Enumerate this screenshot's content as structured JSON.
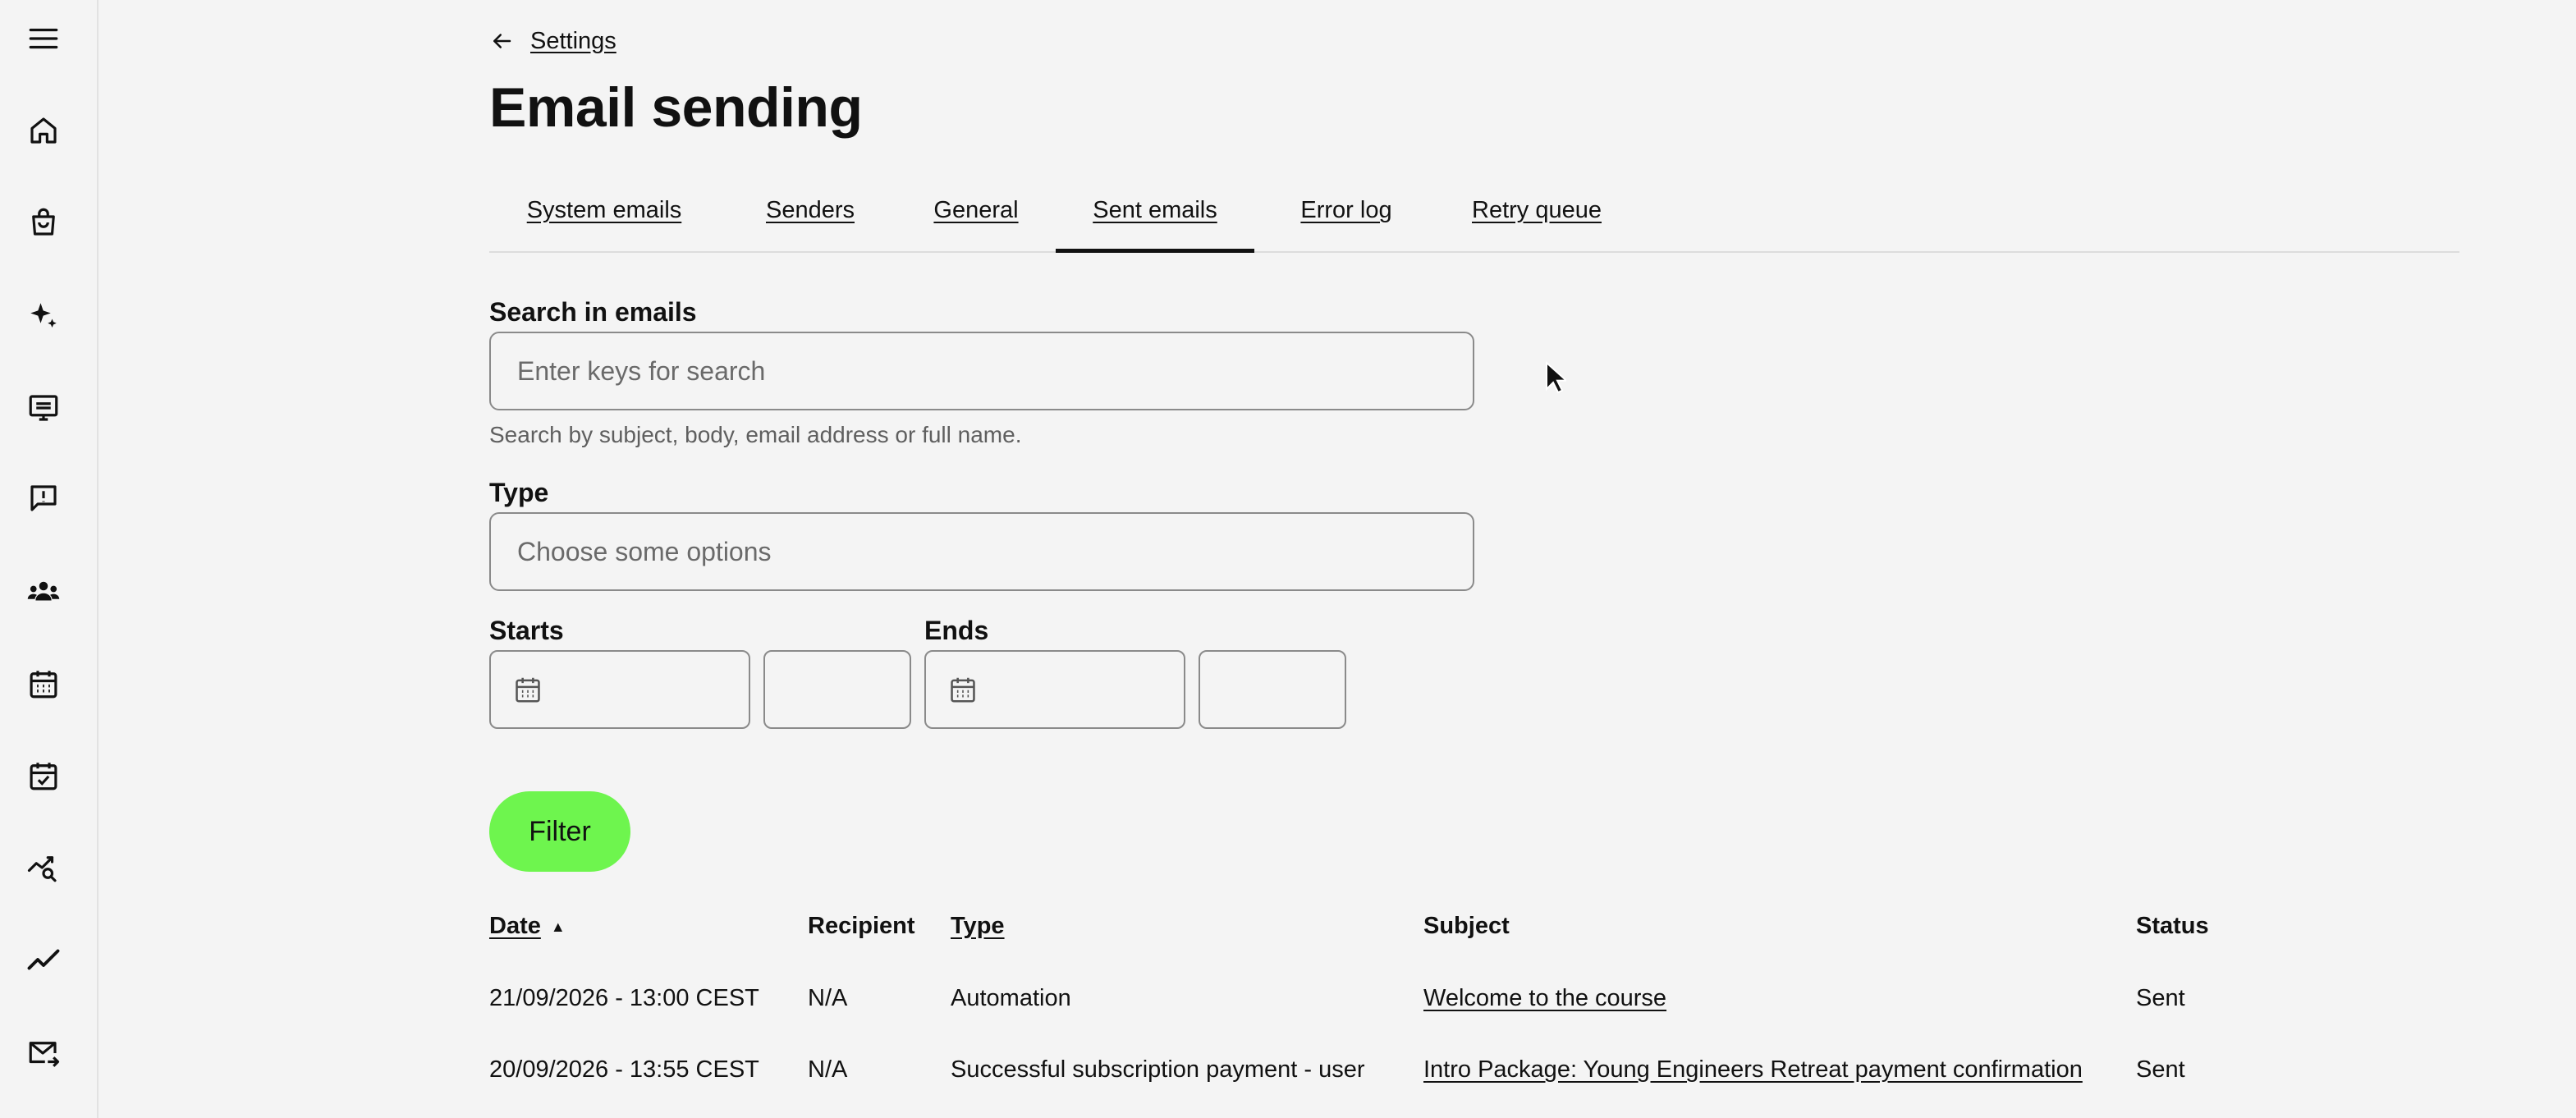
{
  "sidebar": {
    "items": [
      {
        "icon": "menu-icon"
      },
      {
        "icon": "home-icon"
      },
      {
        "icon": "shopping-bag-icon"
      },
      {
        "icon": "sparkles-icon"
      },
      {
        "icon": "presentation-icon"
      },
      {
        "icon": "alert-message-icon"
      },
      {
        "icon": "users-icon"
      },
      {
        "icon": "calendar-icon"
      },
      {
        "icon": "calendar-check-icon"
      },
      {
        "icon": "analytics-search-icon"
      },
      {
        "icon": "trend-line-icon"
      },
      {
        "icon": "mail-forward-icon"
      }
    ]
  },
  "breadcrumb": {
    "back_label": "Settings"
  },
  "page": {
    "title": "Email sending"
  },
  "tabs": [
    {
      "label": "System emails",
      "active": false
    },
    {
      "label": "Senders",
      "active": false
    },
    {
      "label": "General",
      "active": false
    },
    {
      "label": "Sent emails",
      "active": true
    },
    {
      "label": "Error log",
      "active": false
    },
    {
      "label": "Retry queue",
      "active": false
    }
  ],
  "filters": {
    "search_label": "Search in emails",
    "search_placeholder": "Enter keys for search",
    "search_value": "",
    "search_help": "Search by subject, body, email address or full name.",
    "type_label": "Type",
    "type_placeholder": "Choose some options",
    "starts_label": "Starts",
    "ends_label": "Ends",
    "filter_button": "Filter"
  },
  "table": {
    "columns": [
      {
        "label": "Date",
        "sortable": true,
        "sort": "asc"
      },
      {
        "label": "Recipient",
        "sortable": false
      },
      {
        "label": "Type",
        "sortable": true
      },
      {
        "label": "Subject",
        "sortable": false
      },
      {
        "label": "Status",
        "sortable": false
      }
    ],
    "sort_arrow": "▲",
    "rows": [
      {
        "date": "21/09/2026 - 13:00 CEST",
        "recipient": "N/A",
        "type": "Automation",
        "subject": "Welcome to the course",
        "status": "Sent"
      },
      {
        "date": "20/09/2026 - 13:55 CEST",
        "recipient": "N/A",
        "type": "Successful subscription payment - user",
        "subject": "Intro Package: Young Engineers Retreat payment confirmation",
        "status": "Sent"
      }
    ]
  },
  "colors": {
    "accent": "#6ef54e",
    "background": "#f4f4f4",
    "border": "#8a8a8a"
  }
}
